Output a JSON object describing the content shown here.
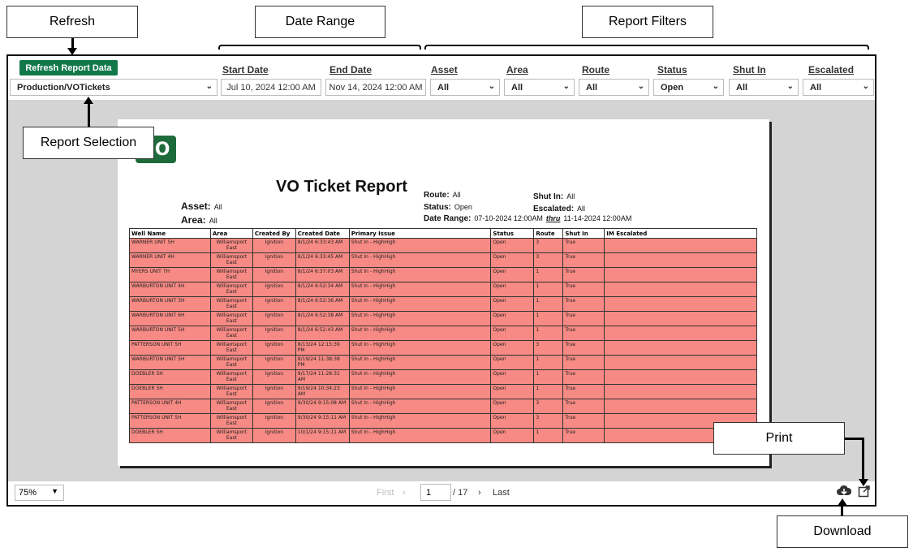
{
  "callouts": {
    "refresh": "Refresh",
    "date_range": "Date Range",
    "report_filters": "Report Filters",
    "report_selection": "Report Selection",
    "print": "Print",
    "download": "Download"
  },
  "toolbar": {
    "refresh_label": "Refresh Report Data",
    "report_select": "Production/VOTickets",
    "start_date_label": "Start Date",
    "start_date_value": "Jul 10, 2024 12:00 AM",
    "end_date_label": "End Date",
    "end_date_value": "Nov 14, 2024 12:00 AM",
    "filters": [
      {
        "label": "Asset",
        "value": "All"
      },
      {
        "label": "Area",
        "value": "All"
      },
      {
        "label": "Route",
        "value": "All"
      },
      {
        "label": "Status",
        "value": "Open"
      },
      {
        "label": "Shut In",
        "value": "All"
      },
      {
        "label": "Escalated",
        "value": "All"
      }
    ]
  },
  "report": {
    "logo_text": "CO",
    "title": "VO Ticket Report",
    "asset_label": "Asset:",
    "asset_value": "All",
    "area_label": "Area:",
    "area_value": "All",
    "route_label": "Route:",
    "route_value": "All",
    "status_label": "Status:",
    "status_value": "Open",
    "date_range_label": "Date Range:",
    "date_range_from": "07-10-2024 12:00AM",
    "date_range_thru": "thru",
    "date_range_to": "11-14-2024 12:00AM",
    "shutin_label": "Shut In:",
    "shutin_value": "All",
    "escalated_label": "Escalated:",
    "escalated_value": "All",
    "columns": [
      "Well Name",
      "Area",
      "Created By",
      "Created Date",
      "Primary Issue",
      "Status",
      "Route",
      "Shut In",
      "IM Escalated"
    ],
    "rows": [
      [
        "WARNER UNIT 5H",
        "Williamsport East",
        "Ignition",
        "8/1/24 6:33:43 AM",
        "Shut In - HighHigh",
        "Open",
        "3",
        "True",
        ""
      ],
      [
        "WARNER UNIT 4H",
        "Williamsport East",
        "Ignition",
        "8/1/24 6:33:45 AM",
        "Shut In - HighHigh",
        "Open",
        "3",
        "True",
        ""
      ],
      [
        "MYERS UNIT 7H",
        "Williamsport East",
        "Ignition",
        "8/1/24 6:37:03 AM",
        "Shut In - HighHigh",
        "Open",
        "1",
        "True",
        ""
      ],
      [
        "WARBURTON UNIT 4H",
        "Williamsport East",
        "Ignition",
        "8/1/24 6:52:34 AM",
        "Shut In - HighHigh",
        "Open",
        "1",
        "True",
        ""
      ],
      [
        "WARBURTON UNIT 3H",
        "Williamsport East",
        "Ignition",
        "8/1/24 6:52:36 AM",
        "Shut In - HighHigh",
        "Open",
        "1",
        "True",
        ""
      ],
      [
        "WARBURTON UNIT 6H",
        "Williamsport East",
        "Ignition",
        "8/1/24 6:52:38 AM",
        "Shut In - HighHigh",
        "Open",
        "1",
        "True",
        ""
      ],
      [
        "WARBURTON UNIT 5H",
        "Williamsport East",
        "Ignition",
        "8/1/24 6:52:43 AM",
        "Shut In - HighHigh",
        "Open",
        "1",
        "True",
        ""
      ],
      [
        "PATTERSON UNIT 5H",
        "Williamsport East",
        "Ignition",
        "8/13/24 12:15:39 PM",
        "Shut In - HighHigh",
        "Open",
        "3",
        "True",
        ""
      ],
      [
        "WARBURTON UNIT 5H",
        "Williamsport East",
        "Ignition",
        "8/19/24 11:38:38 PM",
        "Shut In - HighHigh",
        "Open",
        "1",
        "True",
        ""
      ],
      [
        "DOEBLER 5H",
        "Williamsport East",
        "Ignition",
        "9/17/24 11:28:31 AM",
        "Shut In - HighHigh",
        "Open",
        "1",
        "True",
        ""
      ],
      [
        "DOEBLER 5H",
        "Williamsport East",
        "Ignition",
        "9/19/24 10:34:23 AM",
        "Shut In - HighHigh",
        "Open",
        "1",
        "True",
        ""
      ],
      [
        "PATTERSON UNIT 4H",
        "Williamsport East",
        "Ignition",
        "9/30/24 9:15:08 AM",
        "Shut In - HighHigh",
        "Open",
        "3",
        "True",
        ""
      ],
      [
        "PATTERSON UNIT 5H",
        "Williamsport East",
        "Ignition",
        "9/30/24 9:15:11 AM",
        "Shut In - HighHigh",
        "Open",
        "3",
        "True",
        ""
      ],
      [
        "DOEBLER 5H",
        "Williamsport East",
        "Ignition",
        "10/1/24 9:15:11 AM",
        "Shut In - HighHigh",
        "Open",
        "1",
        "True",
        ""
      ]
    ]
  },
  "bottombar": {
    "zoom": "75%",
    "first": "First",
    "page": "1",
    "total": "/ 17",
    "last": "Last"
  },
  "icons": {
    "download": "cloud-download-icon",
    "print": "export-icon"
  },
  "colors": {
    "accent": "#12784a",
    "row_highlight": "#f78a84",
    "frame_bg": "#d4d4d4"
  }
}
